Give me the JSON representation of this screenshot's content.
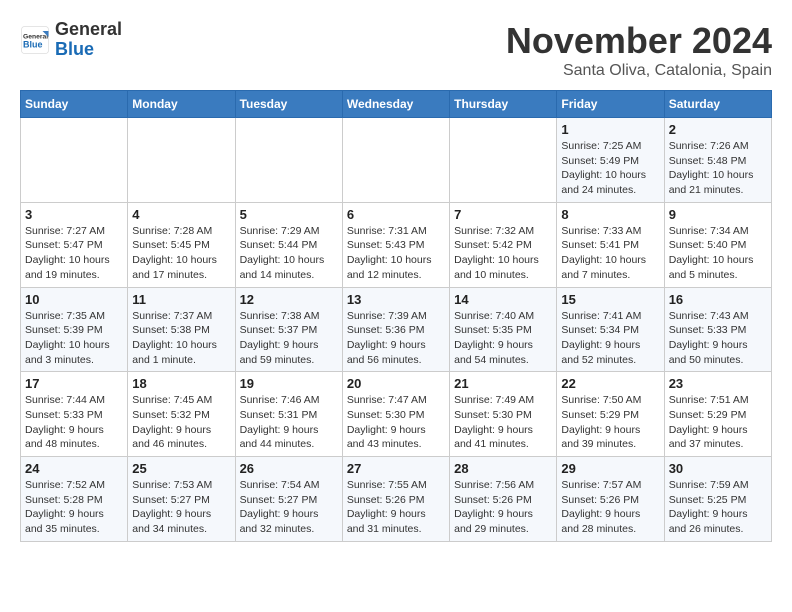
{
  "logo": {
    "general": "General",
    "blue": "Blue"
  },
  "title": "November 2024",
  "location": "Santa Oliva, Catalonia, Spain",
  "weekdays": [
    "Sunday",
    "Monday",
    "Tuesday",
    "Wednesday",
    "Thursday",
    "Friday",
    "Saturday"
  ],
  "weeks": [
    [
      {
        "day": "",
        "info": ""
      },
      {
        "day": "",
        "info": ""
      },
      {
        "day": "",
        "info": ""
      },
      {
        "day": "",
        "info": ""
      },
      {
        "day": "",
        "info": ""
      },
      {
        "day": "1",
        "info": "Sunrise: 7:25 AM\nSunset: 5:49 PM\nDaylight: 10 hours and 24 minutes."
      },
      {
        "day": "2",
        "info": "Sunrise: 7:26 AM\nSunset: 5:48 PM\nDaylight: 10 hours and 21 minutes."
      }
    ],
    [
      {
        "day": "3",
        "info": "Sunrise: 7:27 AM\nSunset: 5:47 PM\nDaylight: 10 hours and 19 minutes."
      },
      {
        "day": "4",
        "info": "Sunrise: 7:28 AM\nSunset: 5:45 PM\nDaylight: 10 hours and 17 minutes."
      },
      {
        "day": "5",
        "info": "Sunrise: 7:29 AM\nSunset: 5:44 PM\nDaylight: 10 hours and 14 minutes."
      },
      {
        "day": "6",
        "info": "Sunrise: 7:31 AM\nSunset: 5:43 PM\nDaylight: 10 hours and 12 minutes."
      },
      {
        "day": "7",
        "info": "Sunrise: 7:32 AM\nSunset: 5:42 PM\nDaylight: 10 hours and 10 minutes."
      },
      {
        "day": "8",
        "info": "Sunrise: 7:33 AM\nSunset: 5:41 PM\nDaylight: 10 hours and 7 minutes."
      },
      {
        "day": "9",
        "info": "Sunrise: 7:34 AM\nSunset: 5:40 PM\nDaylight: 10 hours and 5 minutes."
      }
    ],
    [
      {
        "day": "10",
        "info": "Sunrise: 7:35 AM\nSunset: 5:39 PM\nDaylight: 10 hours and 3 minutes."
      },
      {
        "day": "11",
        "info": "Sunrise: 7:37 AM\nSunset: 5:38 PM\nDaylight: 10 hours and 1 minute."
      },
      {
        "day": "12",
        "info": "Sunrise: 7:38 AM\nSunset: 5:37 PM\nDaylight: 9 hours and 59 minutes."
      },
      {
        "day": "13",
        "info": "Sunrise: 7:39 AM\nSunset: 5:36 PM\nDaylight: 9 hours and 56 minutes."
      },
      {
        "day": "14",
        "info": "Sunrise: 7:40 AM\nSunset: 5:35 PM\nDaylight: 9 hours and 54 minutes."
      },
      {
        "day": "15",
        "info": "Sunrise: 7:41 AM\nSunset: 5:34 PM\nDaylight: 9 hours and 52 minutes."
      },
      {
        "day": "16",
        "info": "Sunrise: 7:43 AM\nSunset: 5:33 PM\nDaylight: 9 hours and 50 minutes."
      }
    ],
    [
      {
        "day": "17",
        "info": "Sunrise: 7:44 AM\nSunset: 5:33 PM\nDaylight: 9 hours and 48 minutes."
      },
      {
        "day": "18",
        "info": "Sunrise: 7:45 AM\nSunset: 5:32 PM\nDaylight: 9 hours and 46 minutes."
      },
      {
        "day": "19",
        "info": "Sunrise: 7:46 AM\nSunset: 5:31 PM\nDaylight: 9 hours and 44 minutes."
      },
      {
        "day": "20",
        "info": "Sunrise: 7:47 AM\nSunset: 5:30 PM\nDaylight: 9 hours and 43 minutes."
      },
      {
        "day": "21",
        "info": "Sunrise: 7:49 AM\nSunset: 5:30 PM\nDaylight: 9 hours and 41 minutes."
      },
      {
        "day": "22",
        "info": "Sunrise: 7:50 AM\nSunset: 5:29 PM\nDaylight: 9 hours and 39 minutes."
      },
      {
        "day": "23",
        "info": "Sunrise: 7:51 AM\nSunset: 5:29 PM\nDaylight: 9 hours and 37 minutes."
      }
    ],
    [
      {
        "day": "24",
        "info": "Sunrise: 7:52 AM\nSunset: 5:28 PM\nDaylight: 9 hours and 35 minutes."
      },
      {
        "day": "25",
        "info": "Sunrise: 7:53 AM\nSunset: 5:27 PM\nDaylight: 9 hours and 34 minutes."
      },
      {
        "day": "26",
        "info": "Sunrise: 7:54 AM\nSunset: 5:27 PM\nDaylight: 9 hours and 32 minutes."
      },
      {
        "day": "27",
        "info": "Sunrise: 7:55 AM\nSunset: 5:26 PM\nDaylight: 9 hours and 31 minutes."
      },
      {
        "day": "28",
        "info": "Sunrise: 7:56 AM\nSunset: 5:26 PM\nDaylight: 9 hours and 29 minutes."
      },
      {
        "day": "29",
        "info": "Sunrise: 7:57 AM\nSunset: 5:26 PM\nDaylight: 9 hours and 28 minutes."
      },
      {
        "day": "30",
        "info": "Sunrise: 7:59 AM\nSunset: 5:25 PM\nDaylight: 9 hours and 26 minutes."
      }
    ]
  ]
}
